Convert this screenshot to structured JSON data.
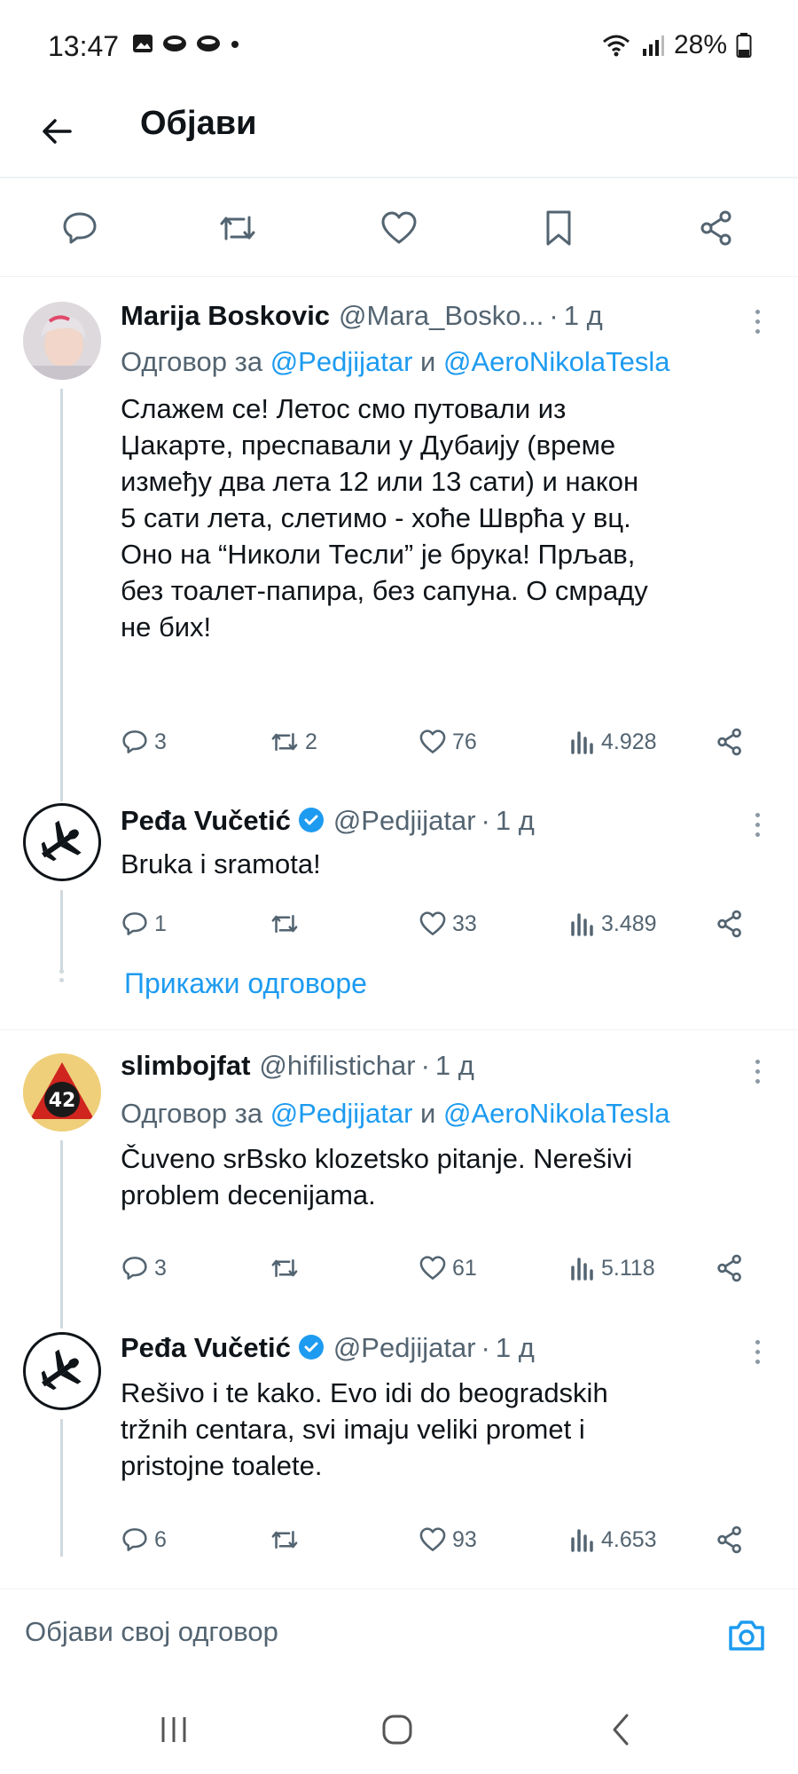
{
  "status": {
    "time": "13:47",
    "battery": "28%"
  },
  "header": {
    "title": "Објави"
  },
  "tweets": [
    {
      "name": "Marija Boskovic",
      "handle": "@Mara_Bosko...",
      "dot": "·",
      "time": "1 д",
      "reply_prefix": "Одговор за",
      "reply_user1": "@Pedjijatar",
      "reply_and": "и",
      "reply_user2": "@AeroNikolaTesla",
      "lines": [
        "Слажем се! Летос смо путовали из",
        "Џакарте, преспавали у Дубаију (време",
        "између два лета 12 или 13 сати) и након",
        "5 сати лета, слетимо - хоће Шврћа у вц.",
        "Оно на “Николи Тесли” је брука! Прљав,",
        "без тоалет-папира, без сапуна. О смраду",
        "не бих!"
      ],
      "replies": "3",
      "reposts": "2",
      "likes": "76",
      "views": "4.928"
    },
    {
      "name": "Peđa Vučetić",
      "handle": "@Pedjijatar",
      "dot": "·",
      "time": "1 д",
      "lines": [
        "Bruka i sramota!"
      ],
      "replies": "1",
      "reposts": "",
      "likes": "33",
      "views": "3.489"
    },
    {
      "name": "slimbojfat",
      "handle": "@hifilistichar",
      "dot": "·",
      "time": "1 д",
      "avatar_text": "42",
      "reply_prefix": "Одговор за",
      "reply_user1": "@Pedjijatar",
      "reply_and": "и",
      "reply_user2": "@AeroNikolaTesla",
      "lines": [
        "Čuveno srBsko klozetsko pitanje. Nerešivi",
        "problem decenijama."
      ],
      "replies": "3",
      "reposts": "",
      "likes": "61",
      "views": "5.118"
    },
    {
      "name": "Peđa Vučetić",
      "handle": "@Pedjijatar",
      "dot": "·",
      "time": "1 д",
      "lines": [
        "Rešivo i te kako. Evo idi do beogradskih",
        "tržnih centara, svi imaju veliki promet i",
        "pristojne toalete."
      ],
      "replies": "6",
      "reposts": "",
      "likes": "93",
      "views": "4.653"
    }
  ],
  "show_replies": "Прикажи одговоре",
  "reply_box": {
    "placeholder": "Објави свој одговор"
  },
  "colors": {
    "accent": "#1d9bf0",
    "text": "#0f1419",
    "secondary": "#536471",
    "border": "#eff3f4"
  }
}
